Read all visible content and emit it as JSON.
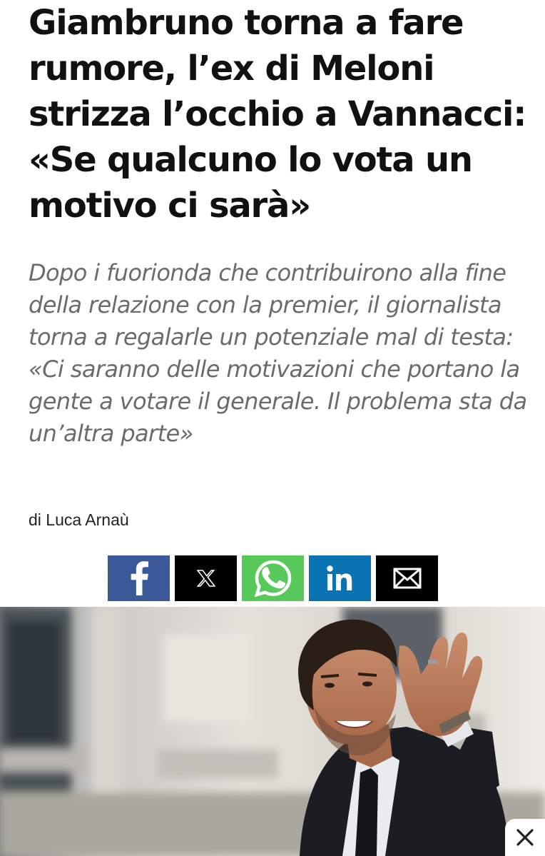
{
  "article": {
    "headline": "Giambruno torna a fare rumore, l’ex di Meloni strizza l’occhio a Vannacci: «Se qualcuno lo vota un motivo ci sarà»",
    "subtitle": "Dopo i fuorionda che contribuirono alla fine della relazione con la premier, il giornalista torna a regalarle un potenziale mal di testa: «Ci saranno delle motivazioni che portano la gente a votare il generale. Il problema sta da un’altra parte»",
    "byline": "di Luca Arnaù"
  },
  "share": {
    "buttons": [
      {
        "icon": "facebook-icon",
        "color": "#3b5998"
      },
      {
        "icon": "x-icon",
        "color": "#000000"
      },
      {
        "icon": "whatsapp-icon",
        "color": "#57c95a"
      },
      {
        "icon": "linkedin-icon",
        "color": "#0a73b1"
      },
      {
        "icon": "email-icon",
        "color": "#000000"
      }
    ]
  },
  "hero": {
    "icon": "photo-man-waving"
  },
  "overlay": {
    "close_icon": "close-icon"
  }
}
